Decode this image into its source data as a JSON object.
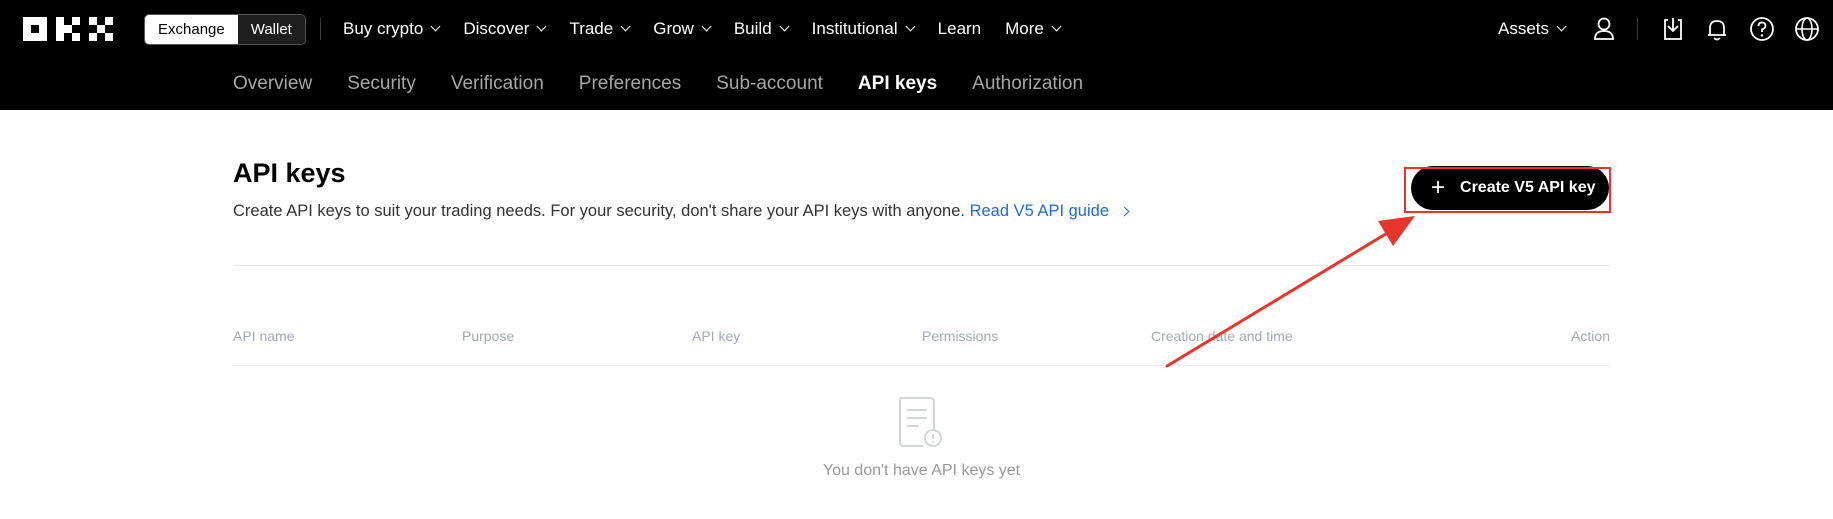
{
  "header": {
    "logo": "OKX",
    "mode_toggle": {
      "exchange_label": "Exchange",
      "wallet_label": "Wallet",
      "selected": "Exchange"
    },
    "menu": [
      {
        "label": "Buy crypto",
        "dropdown": true
      },
      {
        "label": "Discover",
        "dropdown": true
      },
      {
        "label": "Trade",
        "dropdown": true
      },
      {
        "label": "Grow",
        "dropdown": true
      },
      {
        "label": "Build",
        "dropdown": true
      },
      {
        "label": "Institutional",
        "dropdown": true
      },
      {
        "label": "Learn",
        "dropdown": false
      },
      {
        "label": "More",
        "dropdown": true
      }
    ],
    "assets_label": "Assets",
    "icons": [
      "user-icon",
      "download-icon",
      "bell-icon",
      "help-icon",
      "globe-icon"
    ]
  },
  "subnav": {
    "tabs": [
      "Overview",
      "Security",
      "Verification",
      "Preferences",
      "Sub-account",
      "API keys",
      "Authorization"
    ],
    "active": "API keys"
  },
  "main": {
    "title": "API keys",
    "description": "Create API keys to suit your trading needs. For your security, don't share your API keys with anyone.",
    "guide_link": "Read V5 API guide",
    "create_button": "Create V5 API key",
    "table": {
      "columns": [
        "API name",
        "Purpose",
        "API key",
        "Permissions",
        "Creation date and time",
        "Action"
      ],
      "rows": []
    },
    "empty_message": "You don't have API keys yet"
  },
  "annotation": {
    "color": "#e8352b",
    "target": "create-api-key-button"
  },
  "colors": {
    "header_bg": "#000000",
    "link": "#1f6ae5",
    "muted": "#a3a8b5"
  }
}
